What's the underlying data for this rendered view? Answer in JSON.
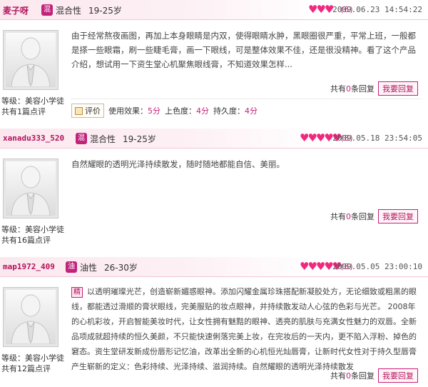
{
  "reviews": [
    {
      "username": "麦子呀",
      "skin_icon_text": "混",
      "skin_type": "混合性",
      "age": "19-25岁",
      "hearts": "♥♥♥",
      "count": "(6)",
      "time": "2009.06.23 14:54:22",
      "content": "由于经常熬夜画图，再加上本身眼睛是内双，使得眼睛水肿，黑眼圈很严重，平常上班，一般都是搽一些眼霜，刷一些睫毛膏，画一下眼线，可是整体效果不佳，还是很没精神。看了这个产品介绍，想试用一下资生堂心机聚焦眼线膏，不知道效果怎样...",
      "level": "等级：美容小学徒",
      "reviews_count": "共有1篇点评",
      "reply_prefix": "共有",
      "reply_num": "0",
      "reply_suffix": "条回复",
      "reply_button": "我要回复",
      "rating_button": "评价",
      "rating_effect_label": "使用效果：",
      "rating_effect": "5分",
      "rating_color_label": "上色度：",
      "rating_color": "4分",
      "rating_last_label": "持久度：",
      "rating_last": "4分"
    },
    {
      "username": "xanadu333_520",
      "skin_icon_text": "混",
      "skin_type": "混合性",
      "age": "19-25岁",
      "hearts": "♥♥♥♥♥",
      "count": "(8)",
      "time": "2009.05.18 23:54:05",
      "content": "自然耀眼的透明光泽持续散发，随时随地都能自信、美丽。",
      "level": "等级：美容小学徒",
      "reviews_count": "共有16篇点评",
      "reply_prefix": "共有",
      "reply_num": "0",
      "reply_suffix": "条回复",
      "reply_button": "我要回复"
    },
    {
      "username": "map1972_409",
      "skin_icon_text": "油",
      "skin_type": "油性",
      "age": "26-30岁",
      "hearts": "♥♥♥♥♥",
      "count": "(8)",
      "time": "2009.05.05 23:00:10",
      "tag": "精",
      "content": "以透明璀璨光芒，创造崭新媚惑眼神。添加闪耀金属珍珠搭配新凝胶处方，无论细致或粗黑的眼线，都能透过滑顺的膏状眼线，完美服贴的妆点眼神，并持续散发动人心弦的色彩与光芒。  2008年的心机彩妆，开启智能美妆时代，让女性拥有魅黠的眼神、透亮的肌肤与充满女性魅力的双唇。全新品项成就超持续的恒久美颜，不只能快速俐落完美上妆，在完妆后的一天内，更不陷入浮粉、掉色的窘态。资生堂研发新成份唇形记忆油，改革出全新的心机恒光灿唇膏，让新时代女性对于持久型唇膏产生崭新的定义：色彩持续、光泽持续、滋润持续。自然耀眼的透明光泽持续散发",
      "level": "等级：美容小学徒",
      "reviews_count": "共有12篇点评",
      "reply_prefix": "共有",
      "reply_num": "0",
      "reply_suffix": "条回复",
      "reply_button": "我要回复"
    }
  ],
  "colors": {
    "accent": "#c7207a",
    "username": "#b2135a",
    "header_bg": "#fbe8ef"
  }
}
